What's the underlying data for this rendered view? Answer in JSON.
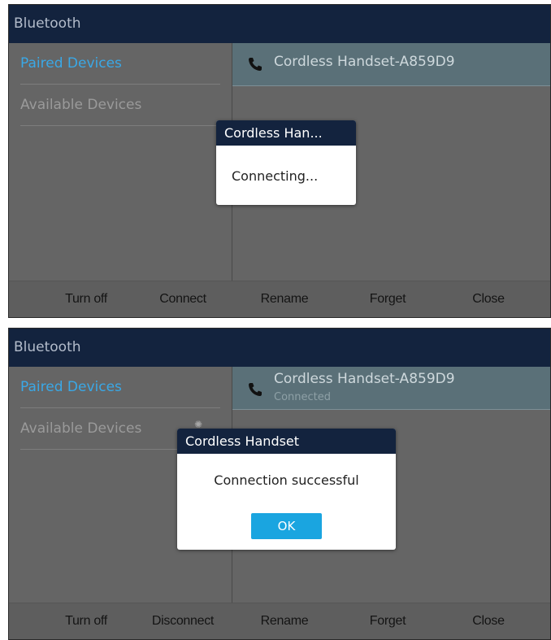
{
  "screen1": {
    "title": "Bluetooth",
    "tabs": [
      "Paired Devices",
      "Available Devices"
    ],
    "device_name": "Cordless Handset-A859D9",
    "dialog": {
      "title": "Cordless Han...",
      "message": "Connecting..."
    },
    "softkeys": [
      "Turn off",
      "Connect",
      "Rename",
      "Forget",
      "Close"
    ]
  },
  "screen2": {
    "title": "Bluetooth",
    "tabs": [
      "Paired Devices",
      "Available Devices"
    ],
    "device_name": "Cordless Handset-A859D9",
    "device_status": "Connected",
    "dialog": {
      "title": "Cordless Handset",
      "message": "Connection successful",
      "ok_label": "OK"
    },
    "softkeys": [
      "Turn off",
      "Disconnect",
      "Rename",
      "Forget",
      "Close"
    ]
  },
  "colors": {
    "titlebar": "#13233e",
    "accent": "#3aa8e6",
    "ok_button": "#1aa5e0",
    "selected_row": "#5a7078"
  },
  "icons": [
    "phone-icon"
  ]
}
